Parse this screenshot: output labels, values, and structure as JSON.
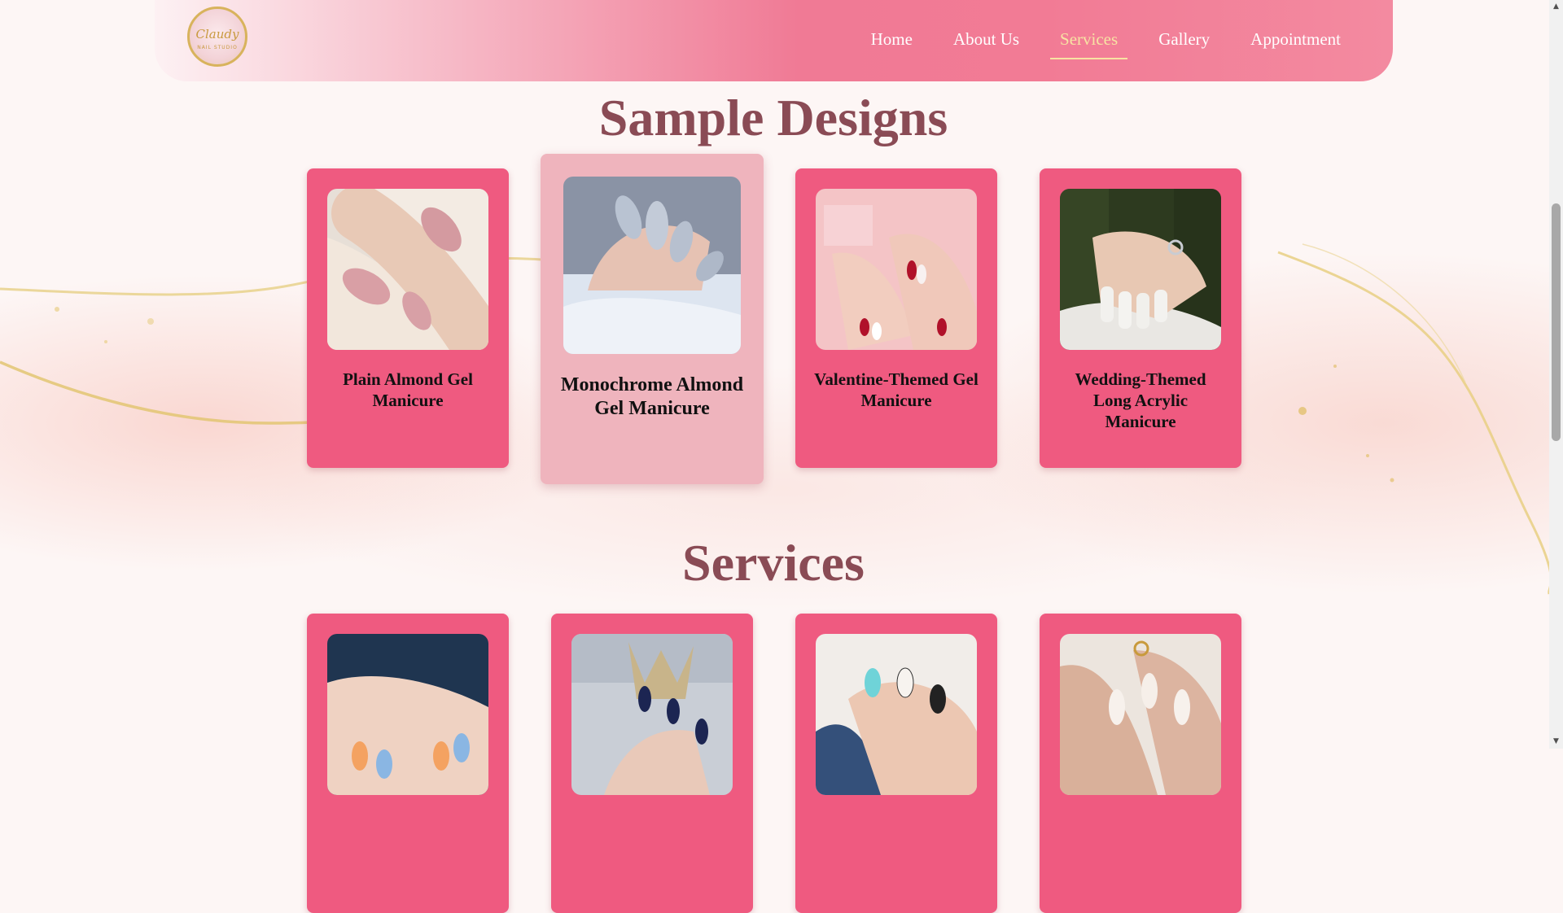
{
  "header": {
    "logo_text": "Claudy",
    "logo_sub": "NAIL STUDIO",
    "nav": [
      {
        "label": "Home"
      },
      {
        "label": "About Us"
      },
      {
        "label": "Services"
      },
      {
        "label": "Gallery"
      },
      {
        "label": "Appointment"
      }
    ],
    "active_nav": "Services"
  },
  "sample_designs": {
    "title": "Sample Designs",
    "cards": [
      {
        "caption": "Plain Almond Gel Manicure"
      },
      {
        "caption": "Monochrome Almond Gel Manicure"
      },
      {
        "caption": "Valentine-Themed Gel Manicure"
      },
      {
        "caption": "Wedding-Themed Long Acrylic Manicure"
      }
    ]
  },
  "services": {
    "title": "Services"
  },
  "colors": {
    "card": "#ef5a80",
    "card_hover": "#efb4bd",
    "heading": "#8a4b55",
    "nav_active": "#f7e3a3"
  }
}
